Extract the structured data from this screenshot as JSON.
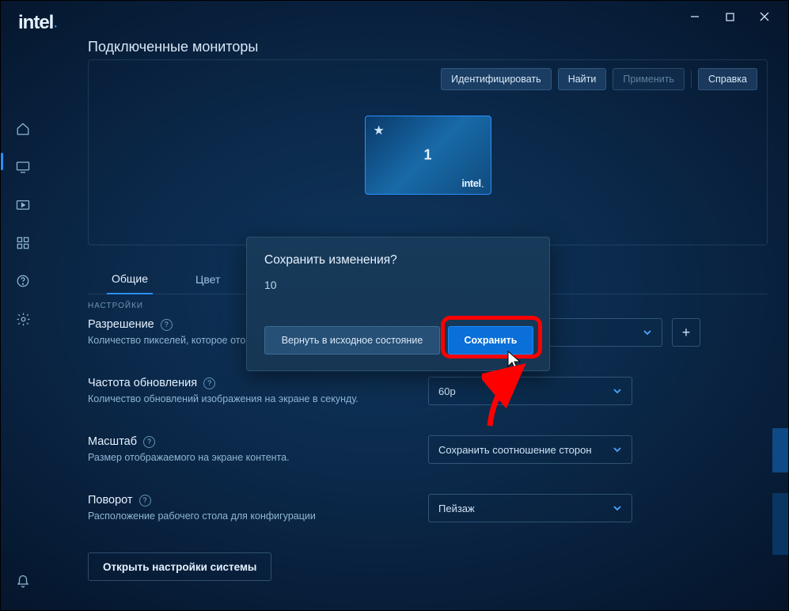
{
  "brand": "intel",
  "page_title": "Подключенные мониторы",
  "toolbar": {
    "identify": "Идентифицировать",
    "find": "Найти",
    "apply": "Применить",
    "help": "Справка"
  },
  "monitor": {
    "number": "1",
    "brand": "intel"
  },
  "tabs": {
    "general": "Общие",
    "color": "Цвет"
  },
  "settings": {
    "section": "НАСТРОЙКИ",
    "resolution": {
      "title": "Разрешение",
      "desc": "Количество пикселей, которое отображается на экране."
    },
    "refresh": {
      "title": "Частота обновления",
      "desc": "Количество обновлений изображения на экране в секунду.",
      "value": "60p"
    },
    "scale": {
      "title": "Масштаб",
      "desc": "Размер отображаемого на экране контента.",
      "value": "Сохранить соотношение сторон"
    },
    "rotation": {
      "title": "Поворот",
      "desc": "Расположение рабочего стола для конфигурации",
      "value": "Пейзаж"
    },
    "system_link": "Открыть настройки системы"
  },
  "modal": {
    "title": "Сохранить изменения?",
    "countdown": "10",
    "revert": "Вернуть в исходное состояние",
    "save": "Сохранить"
  }
}
